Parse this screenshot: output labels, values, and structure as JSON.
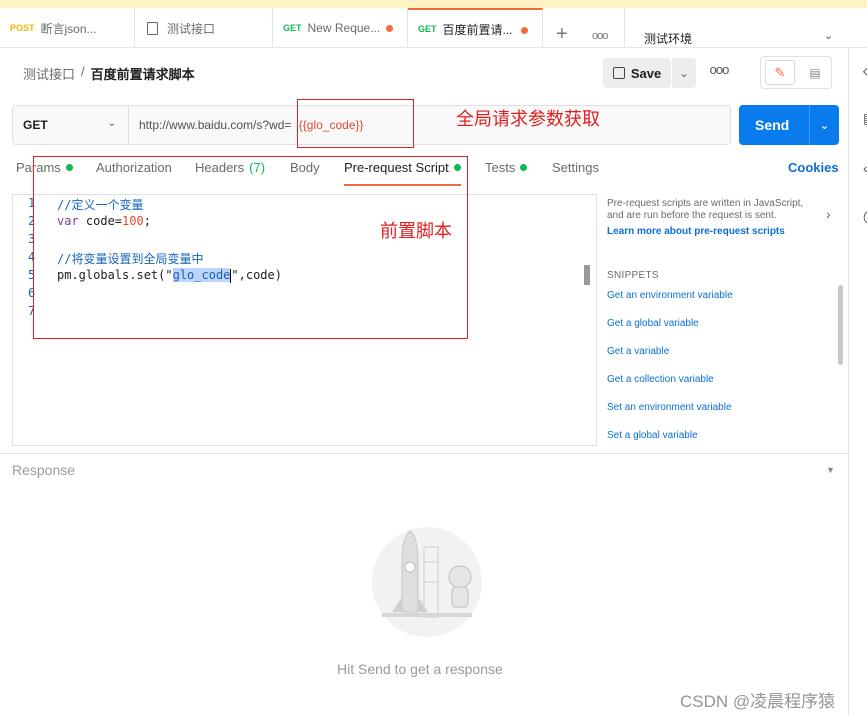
{
  "tabs": [
    {
      "method": "POST",
      "label": "断言json..."
    },
    {
      "method": "",
      "label": "测试接口"
    },
    {
      "method": "GET",
      "label": "New Reque..."
    },
    {
      "method": "GET",
      "label": "百度前置请..."
    }
  ],
  "environment": {
    "label": "测试环境"
  },
  "breadcrumb": {
    "parent": "测试接口",
    "sep": "/",
    "current": "百度前置请求脚本"
  },
  "toolbar": {
    "save_label": "Save",
    "more": "ooo"
  },
  "request": {
    "method": "GET",
    "url_prefix": "http://www.baidu.com/s?wd=",
    "url_var": "{{glo_code}}",
    "send_label": "Send"
  },
  "annotations": {
    "global_param": "全局请求参数获取",
    "pre_script": "前置脚本"
  },
  "request_tabs": {
    "params": "Params",
    "authorization": "Authorization",
    "headers": "Headers",
    "headers_count": "(7)",
    "body": "Body",
    "prerequest": "Pre-request Script",
    "tests": "Tests",
    "settings": "Settings",
    "cookies": "Cookies"
  },
  "editor": {
    "line_numbers": [
      "1",
      "2",
      "3",
      "4",
      "5",
      "6",
      "7"
    ],
    "line1": "//定义一个变量",
    "line2_kw": "var",
    "line2_rest": " code=",
    "line2_num": "100",
    "line2_end": ";",
    "line4": "//将变量设置到全局变量中",
    "line5_a": "pm.globals.set(\"",
    "line5_sel": "glo_code",
    "line5_b": "\",code)"
  },
  "snippets_panel": {
    "hint": "Pre-request scripts are written in JavaScript, and are run before the request is sent.",
    "learn_more": "Learn more about pre-request scripts",
    "heading": "SNIPPETS",
    "items": [
      "Get an environment variable",
      "Get a global variable",
      "Get a variable",
      "Get a collection variable",
      "Set an environment variable",
      "Set a global variable"
    ]
  },
  "response": {
    "title": "Response",
    "empty": "Hit Send to get a response"
  },
  "watermark": "CSDN @凌晨程序猿",
  "colors": {
    "accent": "#f26b3a",
    "send": "#097bed",
    "annotation": "#e02020",
    "link": "#0b6fd2"
  }
}
